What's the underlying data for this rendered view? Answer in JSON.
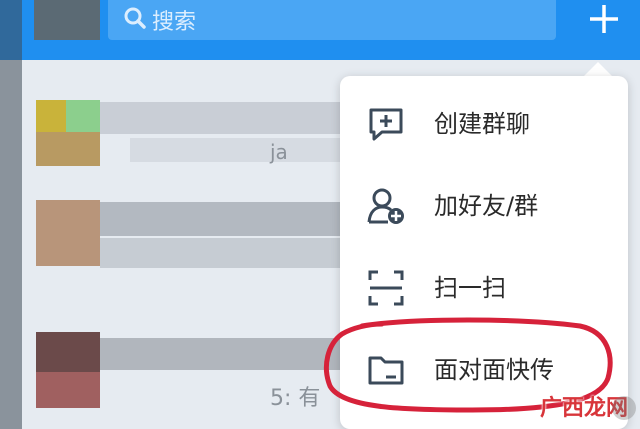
{
  "search": {
    "placeholder": "搜索"
  },
  "chat_list": {
    "fragments": [
      "ja",
      "5: 有"
    ]
  },
  "menu": {
    "items": [
      {
        "label": "创建群聊",
        "icon": "chat-plus-icon"
      },
      {
        "label": "加好友/群",
        "icon": "add-friend-icon"
      },
      {
        "label": "扫一扫",
        "icon": "scan-icon"
      },
      {
        "label": "面对面快传",
        "icon": "folder-icon"
      }
    ]
  },
  "watermark": {
    "text": "广西龙网"
  },
  "colors": {
    "header": "#1f8ff0",
    "highlight_circle": "#d6223a",
    "icon": "#3b4a5a"
  }
}
